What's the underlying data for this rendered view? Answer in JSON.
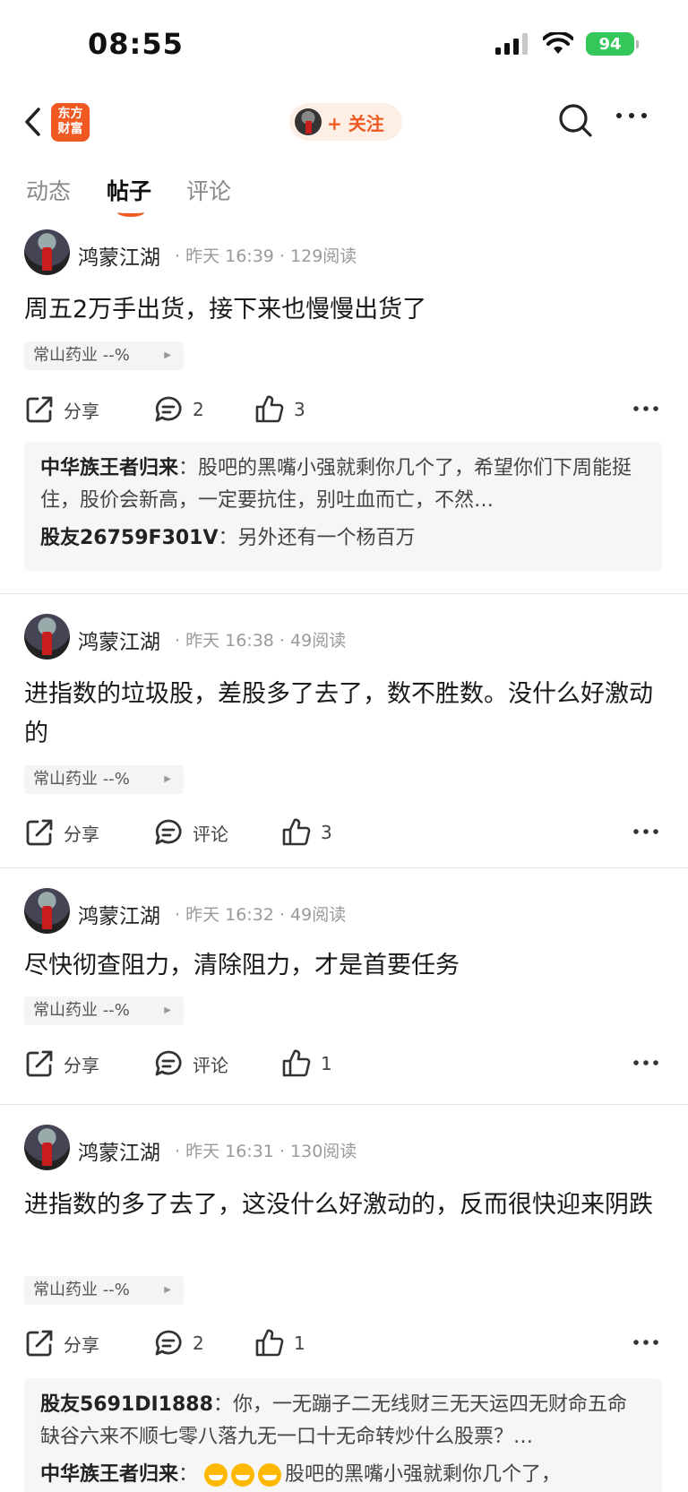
{
  "status": {
    "time": "08:55",
    "battery": "94"
  },
  "nav": {
    "logo_line1": "东方",
    "logo_line2": "财富",
    "follow_label": "+ 关注"
  },
  "tabs": [
    {
      "label": "动态",
      "active": false
    },
    {
      "label": "帖子",
      "active": true
    },
    {
      "label": "评论",
      "active": false
    }
  ],
  "posts": [
    {
      "author": "鸿蒙江湖",
      "date": "昨天 16:39",
      "reads": "129阅读",
      "content": "周五2万手出货，接下来也慢慢出货了",
      "stock": "常山药业 --%",
      "share": "分享",
      "comments": "2",
      "likes": "3",
      "replies": [
        {
          "user": "中华族王者归来",
          "text": "股吧的黑嘴小强就剩你几个了，希望你们下周能挺住，股价会新高，一定要抗住，别吐血而亡，不然…"
        },
        {
          "user": "股友26759F301V",
          "text": "另外还有一个杨百万"
        }
      ]
    },
    {
      "author": "鸿蒙江湖",
      "date": "昨天 16:38",
      "reads": "49阅读",
      "content": "进指数的垃圾股，差股多了去了，数不胜数。没什么好激动的",
      "stock": "常山药业 --%",
      "share": "分享",
      "comments": "评论",
      "likes": "3"
    },
    {
      "author": "鸿蒙江湖",
      "date": "昨天 16:32",
      "reads": "49阅读",
      "content": "尽快彻查阻力，清除阻力，才是首要任务",
      "stock": "常山药业 --%",
      "share": "分享",
      "comments": "评论",
      "likes": "1"
    },
    {
      "author": "鸿蒙江湖",
      "date": "昨天 16:31",
      "reads": "130阅读",
      "content": "进指数的多了去了，这没什么好激动的，反而很快迎来阴跌",
      "stock": "常山药业 --%",
      "share": "分享",
      "comments": "2",
      "likes": "1",
      "replies": [
        {
          "user": "股友5691DI1888",
          "text": "你，一无蹦子二无线财三无天运四无财命五命缺谷六来不顺七零八落九无一口十无命转炒什么股票？…"
        },
        {
          "user": "中华族王者归来",
          "text": "股吧的黑嘴小强就剩你几个了，"
        }
      ]
    }
  ],
  "colors": {
    "accent": "#f05a22",
    "battery": "#34c759"
  },
  "icons": [
    "back-icon",
    "search-icon",
    "more-icon",
    "share-icon",
    "comment-icon",
    "like-icon",
    "wifi-icon",
    "signal-icon"
  ]
}
